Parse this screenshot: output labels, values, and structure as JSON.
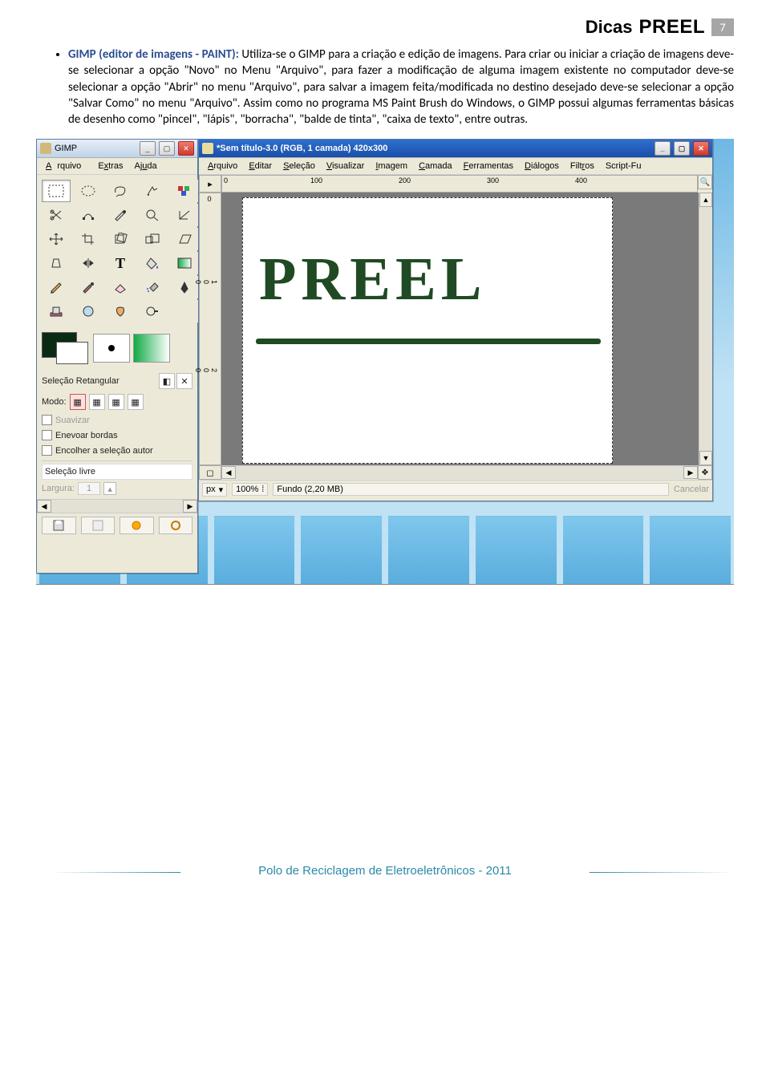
{
  "header": {
    "dicas": "Dicas",
    "preel": "PREEL",
    "pagenum": "7"
  },
  "body": {
    "title_bold": "GIMP (editor de imagens - PAINT):",
    "paragraph": " Utiliza-se o GIMP para a criação e edição de imagens. Para criar ou iniciar a criação de imagens deve-se selecionar a opção \"Novo\" no Menu \"Arquivo\", para fazer a modificação de alguma imagem existente no computador deve-se selecionar a opção \"Abrir\" no menu \"Arquivo\", para salvar a imagem feita/modificada no destino desejado deve-se selecionar a opção \"Salvar Como\" no menu \"Arquivo\". Assim como no programa MS Paint Brush do Windows, o GIMP possui algumas ferramentas básicas de desenho como \"pincel\", \"lápis\", \"borracha\", \"balde de tinta\", \"caixa de texto\", entre outras."
  },
  "toolbox": {
    "title": "GIMP",
    "menu": {
      "arquivo": "Arquivo",
      "extras": "Extras",
      "ajuda": "Ajuda"
    },
    "section_title": "Seleção Retangular",
    "modo_label": "Modo:",
    "opt_suavizar": "Suavizar",
    "opt_enevoar": "Enevoar bordas",
    "opt_encolher": "Encolher a seleção autor",
    "selecao_livre": "Seleção livre",
    "largura_label": "Largura:",
    "largura_val": "1"
  },
  "canvas": {
    "title": "*Sem título-3.0 (RGB, 1 camada) 420x300",
    "menus": {
      "arquivo": "Arquivo",
      "editar": "Editar",
      "selecao": "Seleção",
      "visualizar": "Visualizar",
      "imagem": "Imagem",
      "camada": "Camada",
      "ferramentas": "Ferramentas",
      "dialogos": "Diálogos",
      "filtros": "Filtros",
      "scriptfu": "Script-Fu"
    },
    "ruler_labels": [
      "0",
      "100",
      "200",
      "300",
      "400"
    ],
    "ruler_v_labels": [
      "0",
      "100",
      "200"
    ],
    "canvas_text": "PREEL",
    "status": {
      "px": "px",
      "zoom": "100%",
      "fundo": "Fundo (2,20 MB)",
      "cancel": "Cancelar"
    }
  },
  "footer": {
    "text": "Polo de Reciclagem de Eletroeletrônicos - 2011"
  }
}
